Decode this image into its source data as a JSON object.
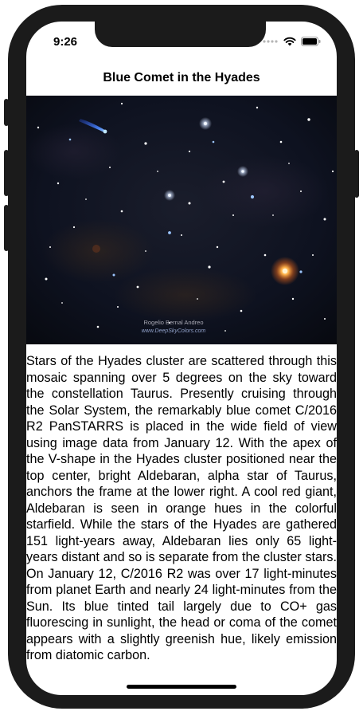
{
  "status_bar": {
    "time": "9:26",
    "icons": [
      "signal-dots-icon",
      "wifi-icon",
      "battery-icon"
    ]
  },
  "nav": {
    "title": "Blue Comet in the Hyades"
  },
  "image": {
    "credit_line1": "Rogelio Bernal Andreo",
    "credit_line2": "www.DeepSkyColors.com"
  },
  "article": {
    "text": "Stars of the Hyades cluster are scattered through this mosaic spanning over 5 degrees on the sky toward the constellation Taurus. Presently cruising through the Solar System, the remarkably blue comet C/2016 R2 PanSTARRS is placed in the wide field of view using image data from January 12. With the apex of the V-shape in the Hyades cluster positioned near the top center, bright Aldebaran, alpha star of Taurus, anchors the frame at the lower right. A cool red giant, Aldebaran is seen in orange hues in the colorful starfield. While the stars of the Hyades are gathered 151 light-years away, Aldebaran lies only 65 light-years distant and so is separate from the cluster stars. On January 12, C/2016 R2 was over 17 light-minutes from planet Earth and nearly 24 light-minutes from the Sun. Its blue tinted tail largely due to CO+ gas fluorescing in sunlight, the head or coma of the comet appears with a slightly greenish hue, likely emission from diatomic carbon."
  },
  "colors": {
    "frame": "#1b1b1b",
    "sky": "#0b0f1a",
    "aldebaran": "#ff8a2a",
    "comet": "#3f7bff"
  }
}
